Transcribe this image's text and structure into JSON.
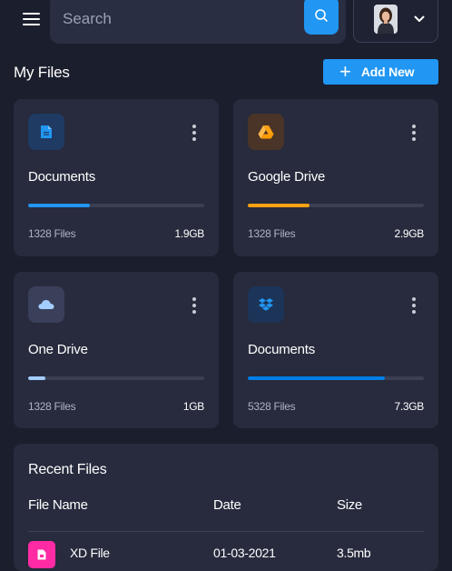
{
  "header": {
    "search_placeholder": "Search"
  },
  "my_files": {
    "title": "My Files",
    "add_button_label": "Add New",
    "cards": [
      {
        "title": "Documents",
        "files": "1328 Files",
        "size": "1.9GB",
        "progress": 0.35,
        "color": "#2196f3",
        "icon": "document-icon"
      },
      {
        "title": "Google Drive",
        "files": "1328 Files",
        "size": "2.9GB",
        "progress": 0.35,
        "color": "#ffa113",
        "icon": "google-drive-icon"
      },
      {
        "title": "One Drive",
        "files": "1328 Files",
        "size": "1GB",
        "progress": 0.1,
        "color": "#a4cdff",
        "icon": "cloud-icon"
      },
      {
        "title": "Documents",
        "files": "5328 Files",
        "size": "7.3GB",
        "progress": 0.78,
        "color": "#007ee5",
        "icon": "dropbox-icon"
      }
    ]
  },
  "recent_files": {
    "title": "Recent Files",
    "columns": [
      "File Name",
      "Date",
      "Size"
    ],
    "rows": [
      {
        "name": "XD File",
        "date": "01-03-2021",
        "size": "3.5mb",
        "icon": "xd-file-icon",
        "color": "#ff2ba4"
      }
    ]
  }
}
